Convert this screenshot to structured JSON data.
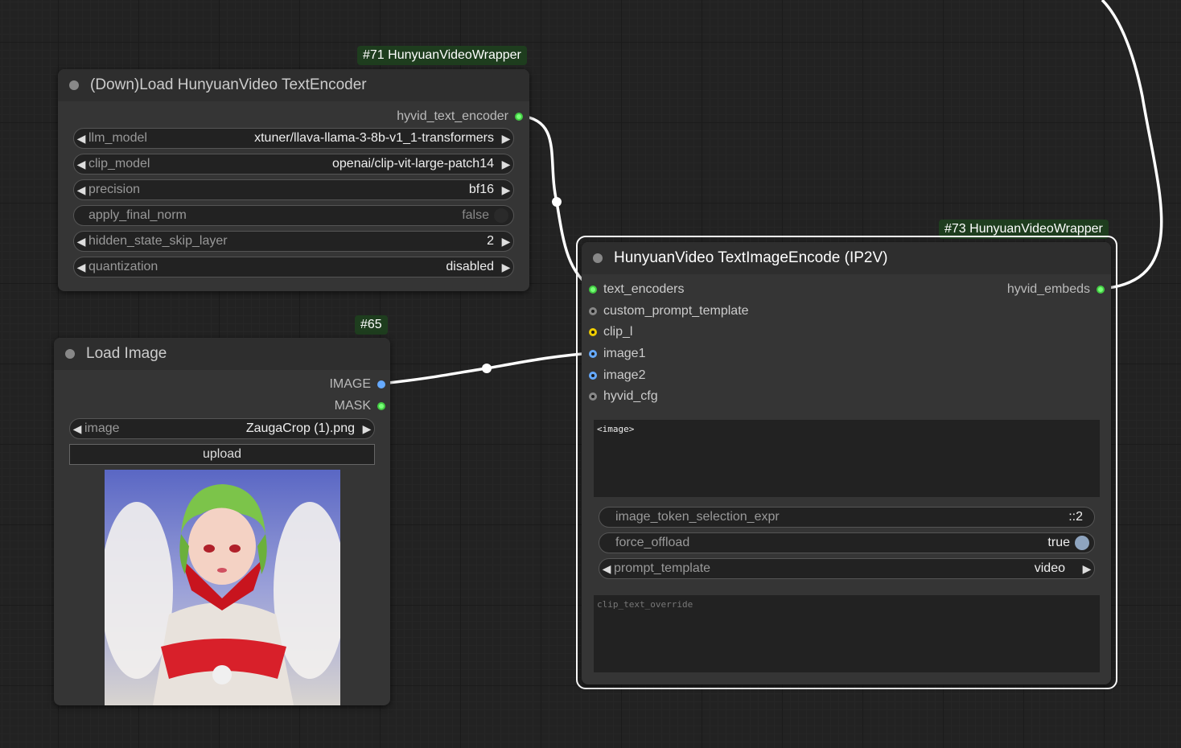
{
  "node71": {
    "badge": "#71 HunyuanVideoWrapper",
    "title": "(Down)Load HunyuanVideo TextEncoder",
    "output": "hyvid_text_encoder",
    "widgets": [
      {
        "label": "llm_model",
        "value": "xtuner/llava-llama-3-8b-v1_1-transformers"
      },
      {
        "label": "clip_model",
        "value": "openai/clip-vit-large-patch14"
      },
      {
        "label": "precision",
        "value": "bf16"
      },
      {
        "label": "apply_final_norm",
        "value": "false"
      },
      {
        "label": "hidden_state_skip_layer",
        "value": "2"
      },
      {
        "label": "quantization",
        "value": "disabled"
      }
    ]
  },
  "node65": {
    "badge": "#65",
    "title": "Load Image",
    "outputs": [
      "IMAGE",
      "MASK"
    ],
    "image_widget": {
      "label": "image",
      "value": "ZaugaCrop (1).png"
    },
    "upload_label": "upload"
  },
  "node73": {
    "badge": "#73 HunyuanVideoWrapper",
    "title": "HunyuanVideo TextImageEncode (IP2V)",
    "inputs": [
      "text_encoders",
      "custom_prompt_template",
      "clip_l",
      "image1",
      "image2",
      "hyvid_cfg"
    ],
    "output": "hyvid_embeds",
    "prompt_text": "<image>",
    "widgets": [
      {
        "label": "image_token_selection_expr",
        "value": "::2"
      },
      {
        "label": "force_offload",
        "value": "true"
      },
      {
        "label": "prompt_template",
        "value": "video"
      }
    ],
    "clip_placeholder": "clip_text_override"
  },
  "colors": {
    "canvas": "#222222",
    "node_body": "#353535",
    "badge_bg": "#1e3d1e",
    "link": "#ffffff",
    "slot_green": "#77ff77",
    "slot_blue": "#66aaff",
    "slot_yellow": "#eecc00"
  }
}
